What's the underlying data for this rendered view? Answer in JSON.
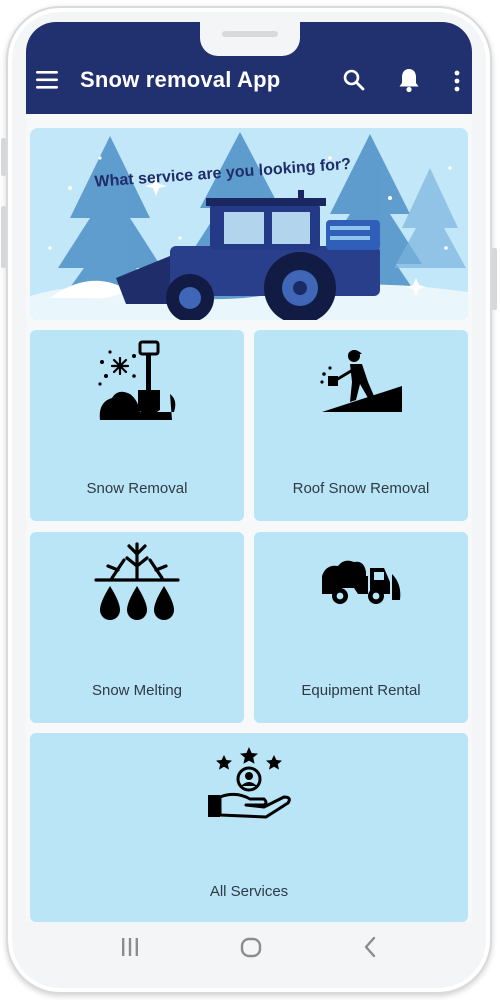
{
  "app": {
    "title": "Snow removal App"
  },
  "header": {
    "menu_icon": "hamburger-menu-icon",
    "search_icon": "search-icon",
    "notification_icon": "bell-icon",
    "more_icon": "more-vertical-icon",
    "background_color": "#21306f"
  },
  "banner": {
    "headline": "What service are you looking for?",
    "illustration": "snow-plow-tractor-illustration"
  },
  "services": [
    {
      "label": "Snow Removal",
      "icon": "snow-shovel-icon"
    },
    {
      "label": "Roof Snow Removal",
      "icon": "roof-shoveling-icon"
    },
    {
      "label": "Snow Melting",
      "icon": "snowflake-melting-icon"
    },
    {
      "label": "Equipment Rental",
      "icon": "snow-plow-truck-icon"
    },
    {
      "label": "All Services",
      "icon": "hand-with-stars-icon"
    }
  ],
  "theme": {
    "tile_color": "#b9e5f7",
    "accent": "#21306f"
  },
  "system_nav": {
    "recents_icon": "recents-icon",
    "home_icon": "home-icon",
    "back_icon": "back-icon"
  }
}
